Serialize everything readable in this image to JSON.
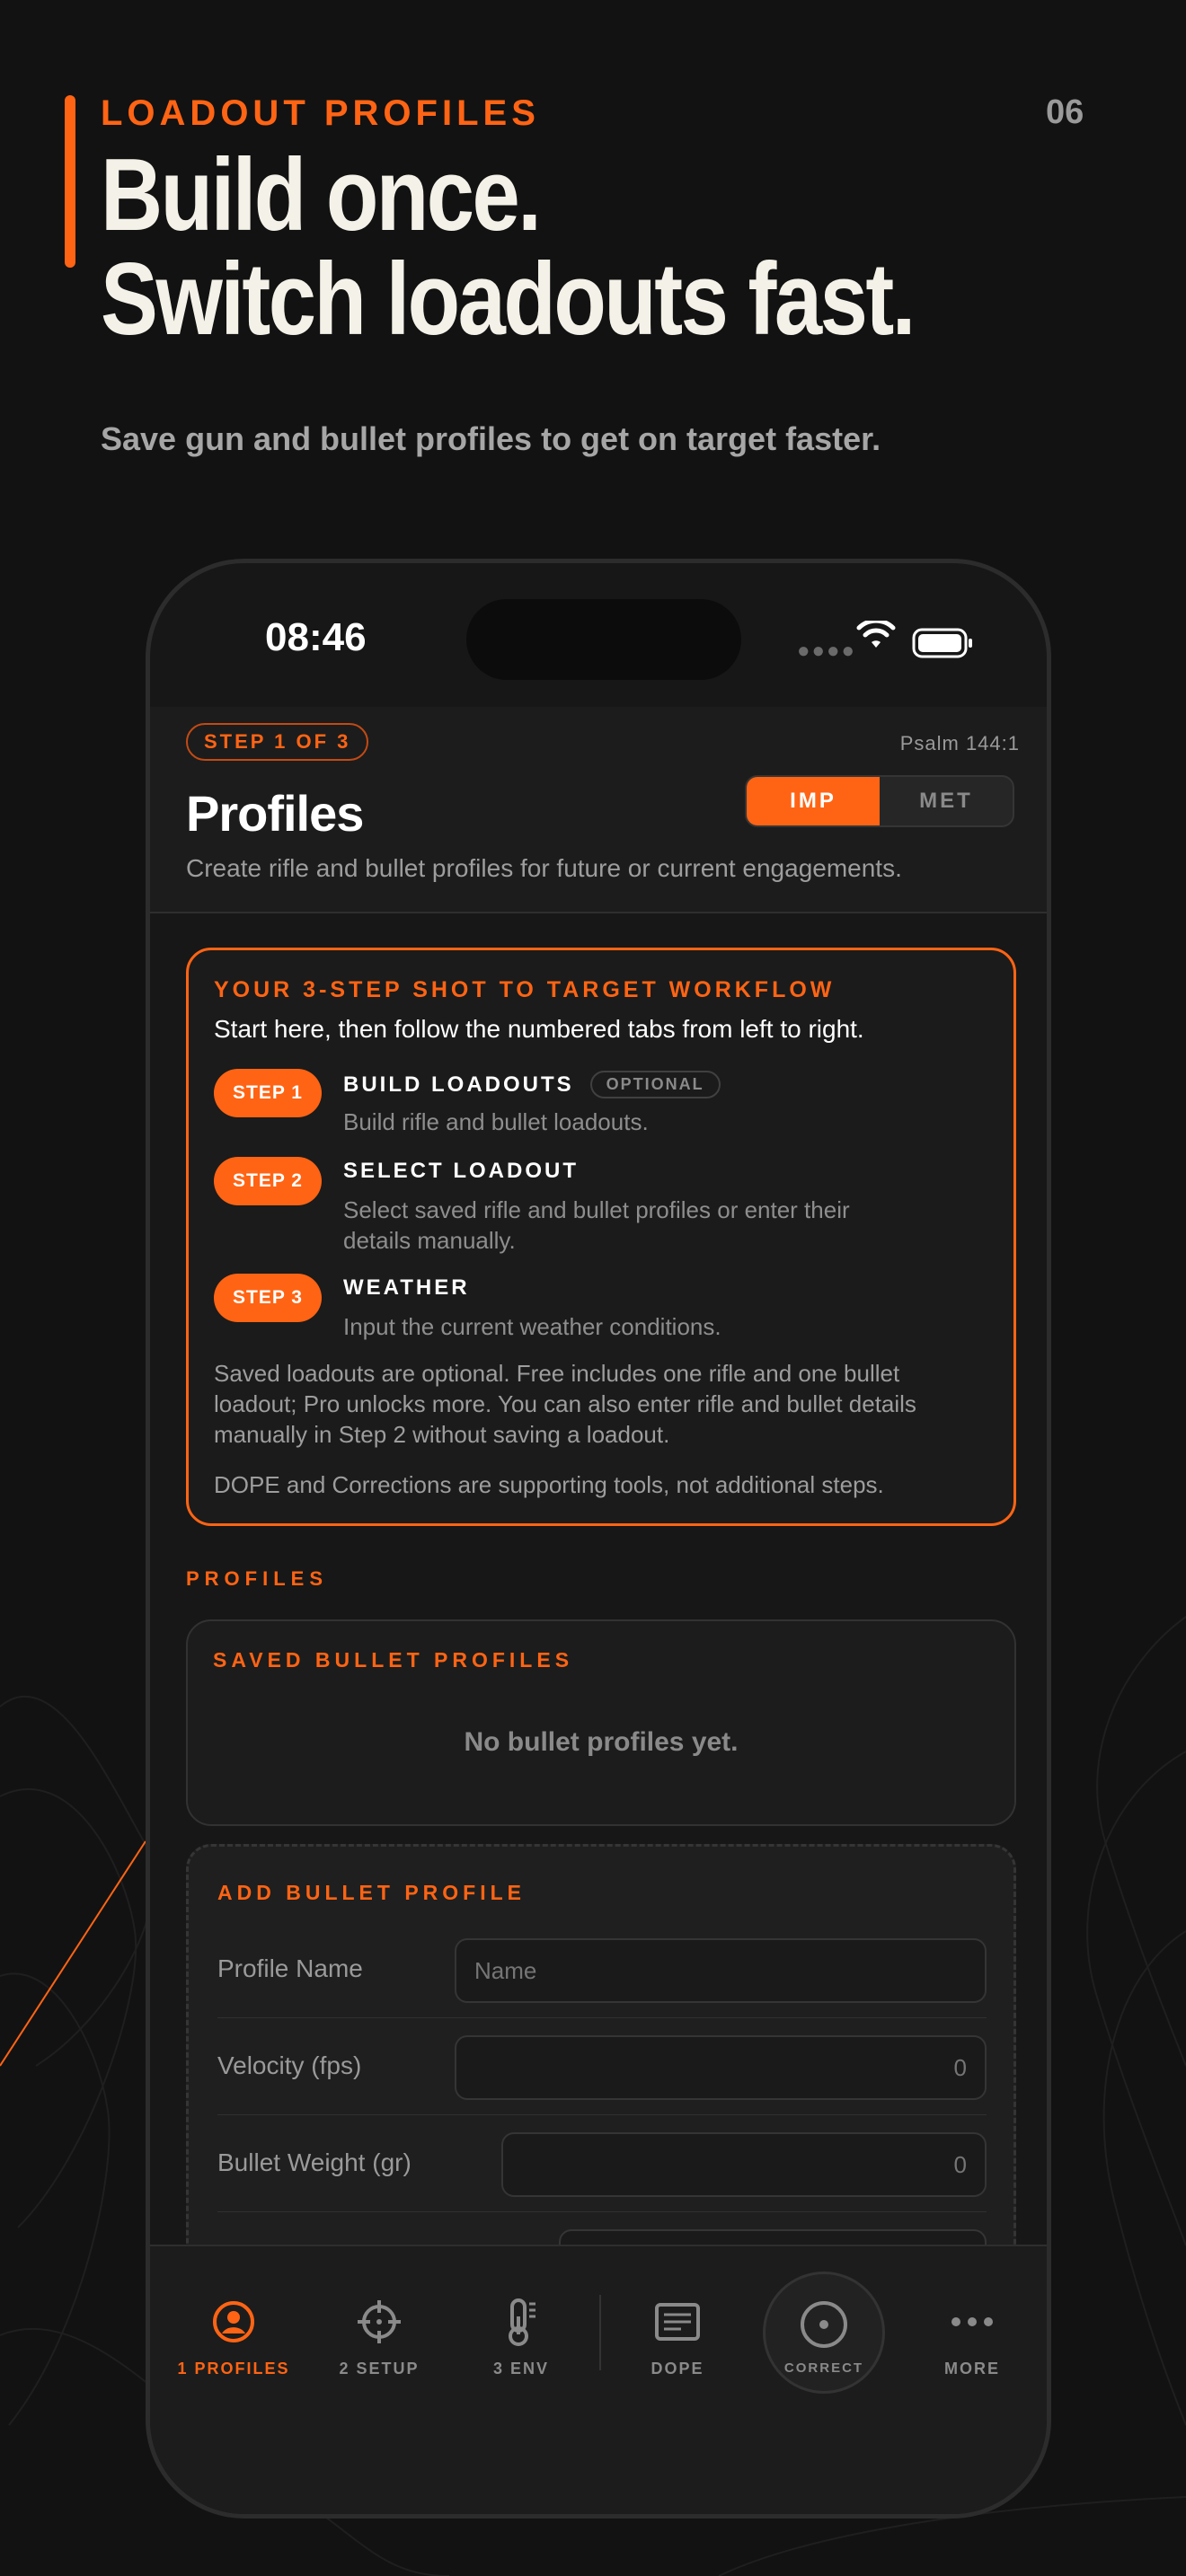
{
  "marketing": {
    "eyebrow": "LOADOUT PROFILES",
    "page_number": "06",
    "headline_line1": "Build once.",
    "headline_line2": "Switch loadouts fast.",
    "subhead": "Save gun and bullet profiles to get on target faster."
  },
  "status_bar": {
    "time": "08:46"
  },
  "header": {
    "step_pill": "STEP 1 OF 3",
    "verse": "Psalm 144:1",
    "title": "Profiles",
    "subtitle": "Create rifle and bullet profiles for future or current engagements.",
    "units": {
      "imp": "IMP",
      "met": "MET",
      "selected": "IMP"
    }
  },
  "workflow": {
    "title": "YOUR 3-STEP SHOT TO TARGET WORKFLOW",
    "intro": "Start here, then follow the numbered tabs from left to right.",
    "steps": [
      {
        "badge": "STEP 1",
        "name": "BUILD LOADOUTS",
        "tag": "OPTIONAL",
        "desc": "Build rifle and bullet loadouts."
      },
      {
        "badge": "STEP 2",
        "name": "SELECT LOADOUT",
        "desc": "Select saved rifle and bullet profiles or enter their details manually."
      },
      {
        "badge": "STEP 3",
        "name": "WEATHER",
        "desc": "Input the current weather conditions."
      }
    ],
    "note1": "Saved loadouts are optional. Free includes one rifle and one bullet loadout; Pro unlocks more. You can also enter rifle and bullet details manually in Step 2 without saving a loadout.",
    "note2": "DOPE and Corrections are supporting tools, not additional steps."
  },
  "profiles": {
    "section_label": "PROFILES",
    "saved_title": "SAVED BULLET PROFILES",
    "empty": "No bullet profiles yet.",
    "add_title": "ADD BULLET PROFILE",
    "fields": [
      {
        "label": "Profile Name",
        "placeholder": "Name"
      },
      {
        "label": "Velocity (fps)",
        "placeholder": "0"
      },
      {
        "label": "Bullet Weight (gr)",
        "placeholder": "0"
      }
    ]
  },
  "tabs": [
    {
      "label": "1 PROFILES",
      "icon": "user-circle-icon",
      "active": true
    },
    {
      "label": "2 SETUP",
      "icon": "crosshair-icon"
    },
    {
      "label": "3 ENV",
      "icon": "thermometer-icon"
    },
    {
      "label": "DOPE",
      "icon": "dope-card-icon"
    },
    {
      "label": "CORRECT",
      "icon": "target-icon"
    },
    {
      "label": "MORE",
      "icon": "more-dots-icon"
    }
  ],
  "colors": {
    "accent": "#ff6414",
    "background": "#121212",
    "card": "#1c1c1c"
  }
}
